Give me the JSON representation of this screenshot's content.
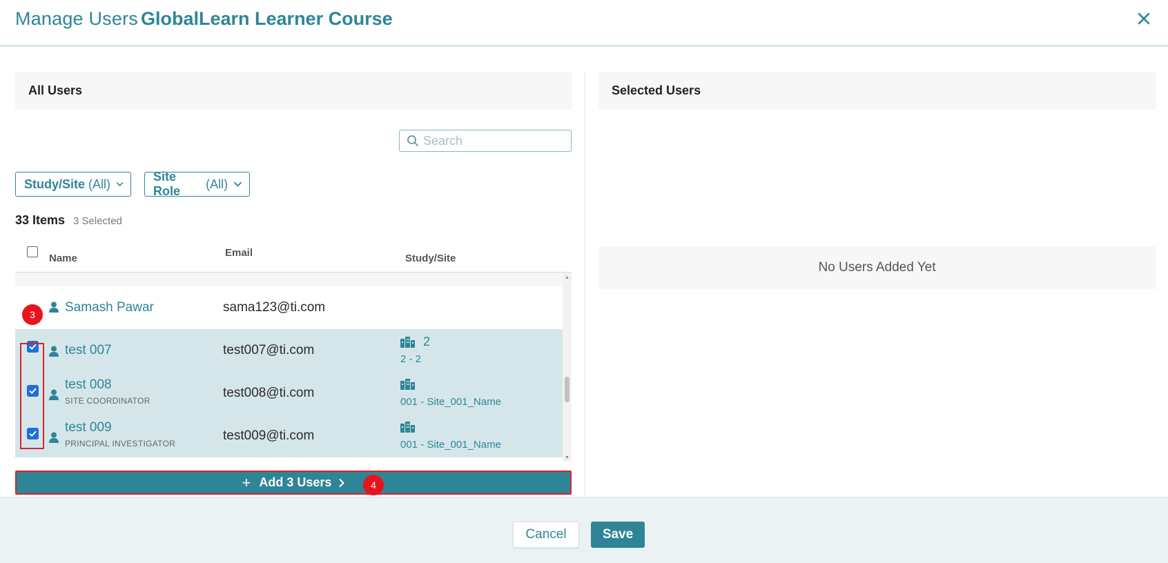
{
  "header": {
    "title": "Manage Users",
    "course": "GlobalLearn Learner Course",
    "close_icon": "close-icon"
  },
  "left_panel": {
    "title": "All Users"
  },
  "right_panel": {
    "title": "Selected Users",
    "empty_text": "No Users Added Yet"
  },
  "search": {
    "placeholder": "Search"
  },
  "filters": [
    {
      "label": "Study/Site",
      "value": "(All)"
    },
    {
      "label": "Site Role",
      "value": "(All)"
    }
  ],
  "summary": {
    "count": "33 Items",
    "selected": "3 Selected"
  },
  "columns": [
    "Name",
    "Email",
    "Study/Site"
  ],
  "users": [
    {
      "name": "Samash Pawar",
      "role": "",
      "email": "sama123@ti.com",
      "site_num": "",
      "site": "",
      "checked": false
    },
    {
      "name": "test 007",
      "role": "",
      "email": "test007@ti.com",
      "site_num": "2",
      "site": "2 - 2",
      "checked": true
    },
    {
      "name": "test 008",
      "role": "SITE COORDINATOR",
      "email": "test008@ti.com",
      "site_num": "",
      "site": "001 - Site_001_Name",
      "checked": true
    },
    {
      "name": "test 009",
      "role": "PRINCIPAL INVESTIGATOR",
      "email": "test009@ti.com",
      "site_num": "",
      "site": "001 - Site_001_Name",
      "checked": true
    }
  ],
  "add_button": {
    "plus": "+",
    "label": "Add 3 Users"
  },
  "markers": [
    "3",
    "4"
  ],
  "footer": {
    "cancel": "Cancel",
    "save": "Save"
  },
  "colors": {
    "accent": "#2e8597",
    "selected_row": "#d5e6ea",
    "annotation": "#e8141c"
  }
}
